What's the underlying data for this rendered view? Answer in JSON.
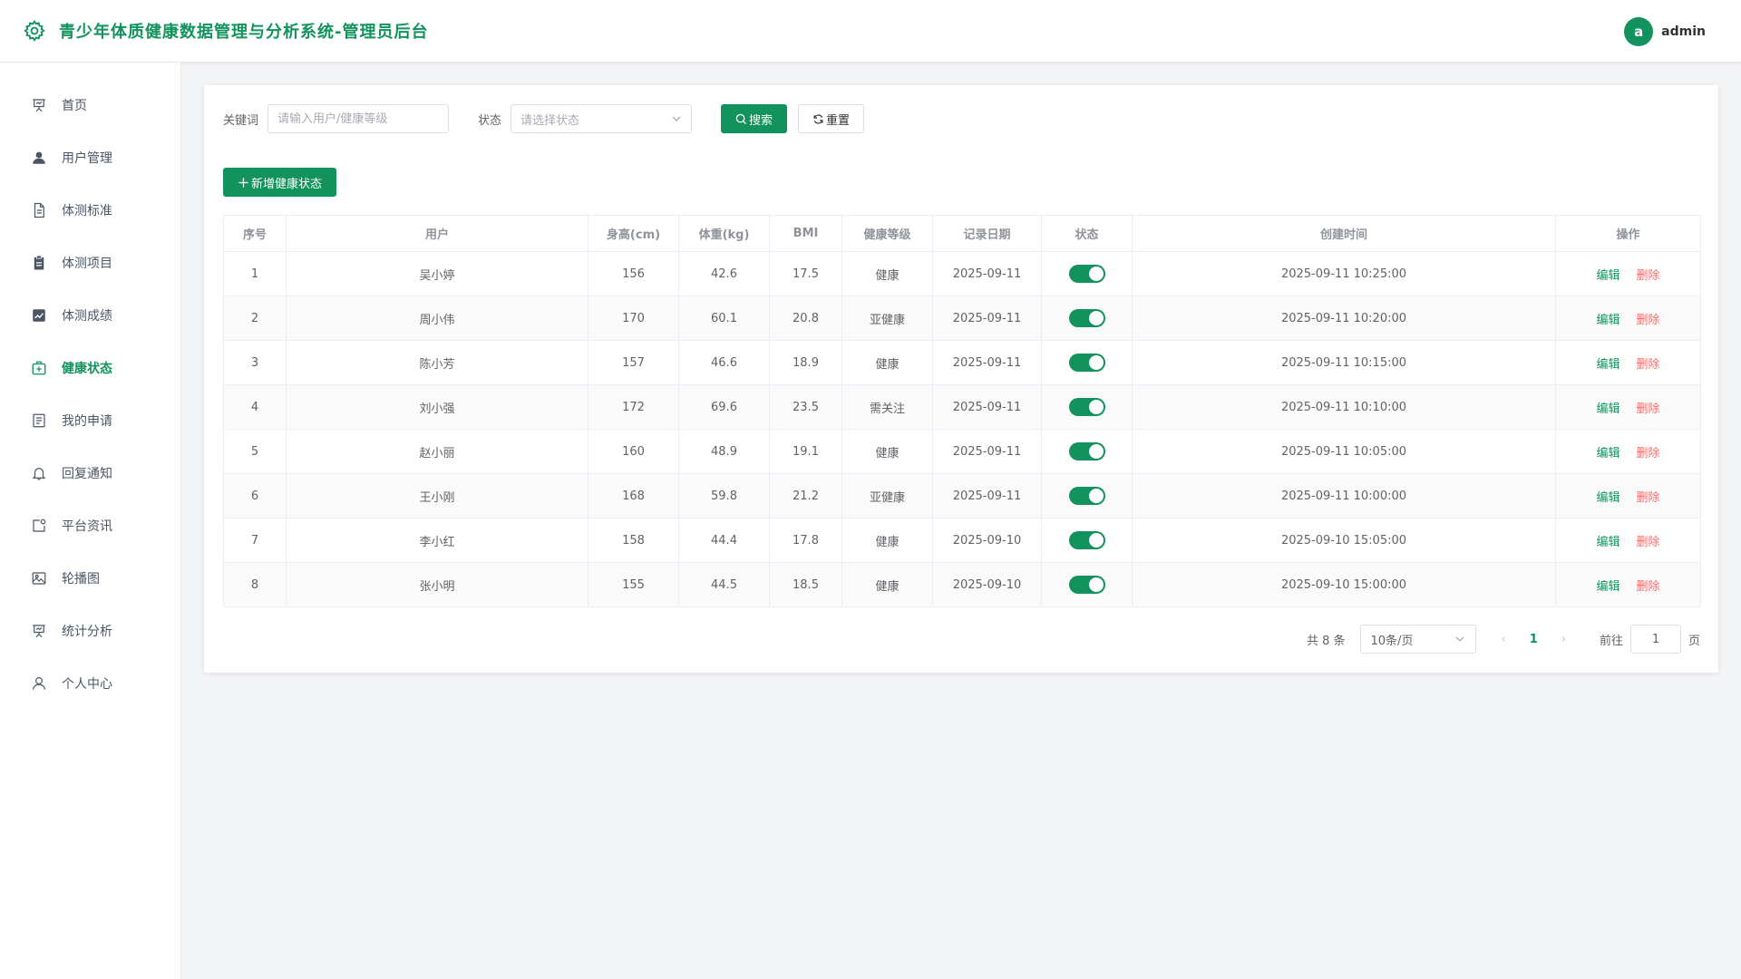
{
  "header": {
    "title": "青少年体质健康数据管理与分析系统-管理员后台",
    "avatar_letter": "a",
    "username": "admin"
  },
  "sidebar": {
    "items": [
      {
        "label": "首页",
        "icon": "presentation-icon"
      },
      {
        "label": "用户管理",
        "icon": "user-icon"
      },
      {
        "label": "体测标准",
        "icon": "document-icon"
      },
      {
        "label": "体测项目",
        "icon": "clipboard-icon"
      },
      {
        "label": "体测成绩",
        "icon": "chart-icon"
      },
      {
        "label": "健康状态",
        "icon": "first-aid-icon",
        "active": true
      },
      {
        "label": "我的申请",
        "icon": "list-icon"
      },
      {
        "label": "回复通知",
        "icon": "bell-icon"
      },
      {
        "label": "平台资讯",
        "icon": "news-icon"
      },
      {
        "label": "轮播图",
        "icon": "picture-icon"
      },
      {
        "label": "统计分析",
        "icon": "presentation-icon"
      },
      {
        "label": "个人中心",
        "icon": "user-outline-icon"
      }
    ]
  },
  "filters": {
    "keyword_label": "关键词",
    "keyword_placeholder": "请输入用户/健康等级",
    "status_label": "状态",
    "status_placeholder": "请选择状态",
    "search_label": "搜索",
    "reset_label": "重置"
  },
  "add_label": "新增健康状态",
  "table": {
    "columns": [
      "序号",
      "用户",
      "身高(cm)",
      "体重(kg)",
      "BMI",
      "健康等级",
      "记录日期",
      "状态",
      "创建时间",
      "操作"
    ],
    "edit_label": "编辑",
    "delete_label": "删除",
    "rows": [
      {
        "no": "1",
        "user": "吴小婷",
        "height": "156",
        "weight": "42.6",
        "bmi": "17.5",
        "level": "健康",
        "date": "2025-09-11",
        "created": "2025-09-11 10:25:00"
      },
      {
        "no": "2",
        "user": "周小伟",
        "height": "170",
        "weight": "60.1",
        "bmi": "20.8",
        "level": "亚健康",
        "date": "2025-09-11",
        "created": "2025-09-11 10:20:00"
      },
      {
        "no": "3",
        "user": "陈小芳",
        "height": "157",
        "weight": "46.6",
        "bmi": "18.9",
        "level": "健康",
        "date": "2025-09-11",
        "created": "2025-09-11 10:15:00"
      },
      {
        "no": "4",
        "user": "刘小强",
        "height": "172",
        "weight": "69.6",
        "bmi": "23.5",
        "level": "需关注",
        "date": "2025-09-11",
        "created": "2025-09-11 10:10:00"
      },
      {
        "no": "5",
        "user": "赵小丽",
        "height": "160",
        "weight": "48.9",
        "bmi": "19.1",
        "level": "健康",
        "date": "2025-09-11",
        "created": "2025-09-11 10:05:00"
      },
      {
        "no": "6",
        "user": "王小刚",
        "height": "168",
        "weight": "59.8",
        "bmi": "21.2",
        "level": "亚健康",
        "date": "2025-09-11",
        "created": "2025-09-11 10:00:00"
      },
      {
        "no": "7",
        "user": "李小红",
        "height": "158",
        "weight": "44.4",
        "bmi": "17.8",
        "level": "健康",
        "date": "2025-09-10",
        "created": "2025-09-10 15:05:00"
      },
      {
        "no": "8",
        "user": "张小明",
        "height": "155",
        "weight": "44.5",
        "bmi": "18.5",
        "level": "健康",
        "date": "2025-09-10",
        "created": "2025-09-10 15:00:00"
      }
    ]
  },
  "pager": {
    "total_text": "共 8 条",
    "page_size": "10条/页",
    "current_page": "1",
    "goto_label": "前往",
    "goto_value": "1",
    "page_suffix": "页"
  },
  "colors": {
    "accent": "#12925c",
    "danger": "#f56c6c"
  }
}
